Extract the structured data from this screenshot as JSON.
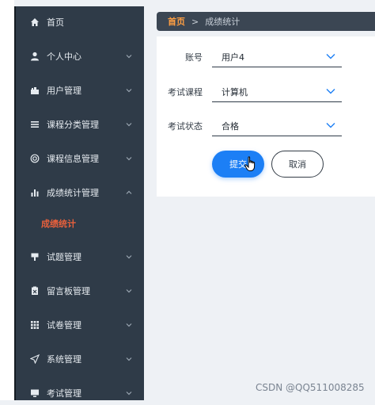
{
  "breadcrumb": {
    "home": "首页",
    "separator": ">",
    "current": "成绩统计"
  },
  "sidebar": {
    "items": [
      {
        "label": "首页",
        "icon": "home-icon"
      },
      {
        "label": "个人中心",
        "icon": "user-icon"
      },
      {
        "label": "用户管理",
        "icon": "user-manage-icon"
      },
      {
        "label": "课程分类管理",
        "icon": "list-icon"
      },
      {
        "label": "课程信息管理",
        "icon": "course-info-icon"
      },
      {
        "label": "成绩统计管理",
        "icon": "bar-chart-icon"
      },
      {
        "label": "试题管理",
        "icon": "question-icon"
      },
      {
        "label": "留言板管理",
        "icon": "message-board-icon"
      },
      {
        "label": "试卷管理",
        "icon": "grid-icon"
      },
      {
        "label": "系统管理",
        "icon": "send-icon"
      },
      {
        "label": "考试管理",
        "icon": "monitor-icon"
      }
    ],
    "active_submenu": {
      "label": "成绩统计"
    }
  },
  "form": {
    "account": {
      "label": "账号",
      "value": "用户4"
    },
    "course": {
      "label": "考试课程",
      "value": "计算机"
    },
    "exam_status": {
      "label": "考试状态",
      "value": "合格"
    },
    "submit_label": "提交",
    "cancel_label": "取消"
  },
  "watermark": "CSDN @QQ511008285",
  "colors": {
    "sidebar_bg": "#2f3b48",
    "accent_blue": "#1c7ff5",
    "breadcrumb_home": "#ff9f43",
    "active_submenu": "#e8603c"
  }
}
